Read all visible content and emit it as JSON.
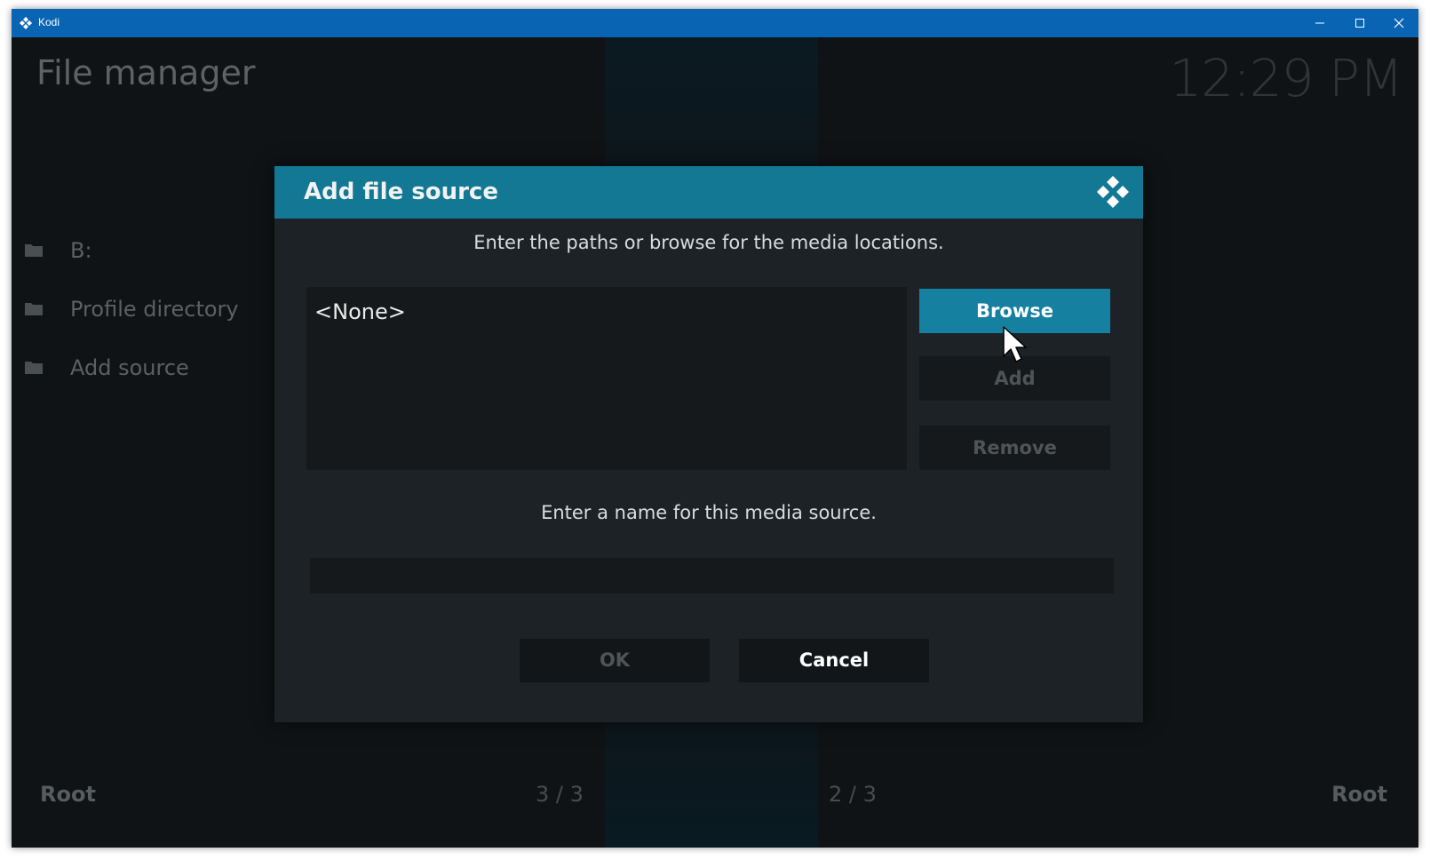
{
  "window": {
    "title": "Kodi",
    "icons": {
      "app": "kodi-icon",
      "minimize": "minimize-icon",
      "maximize": "maximize-icon",
      "close": "close-icon"
    }
  },
  "header": {
    "title": "File manager",
    "clock": "12:29 PM"
  },
  "sidebar": {
    "items": [
      {
        "label": "B:",
        "icon": "folder-icon"
      },
      {
        "label": "Profile directory",
        "icon": "folder-icon"
      },
      {
        "label": "Add source",
        "icon": "folder-icon"
      }
    ]
  },
  "footer": {
    "left_label": "Root",
    "left_page": "3 / 3",
    "right_page": "2 / 3",
    "right_label": "Root"
  },
  "dialog": {
    "title": "Add file source",
    "paths_prompt": "Enter the paths or browse for the media locations.",
    "paths": [
      "<None>"
    ],
    "buttons": {
      "browse": "Browse",
      "add": "Add",
      "remove": "Remove",
      "ok": "OK",
      "cancel": "Cancel"
    },
    "name_prompt": "Enter a name for this media source.",
    "name_value": ""
  },
  "colors": {
    "titlebar": "#0a64b4",
    "dialog_header": "#127894",
    "accent": "#1580a0",
    "background": "#0f1315"
  }
}
